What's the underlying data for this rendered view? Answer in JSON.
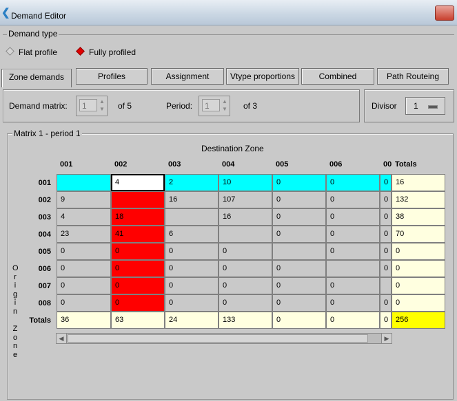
{
  "window": {
    "title": "Demand Editor"
  },
  "demand_type": {
    "label": "Demand type",
    "options": [
      {
        "label": "Flat profile",
        "selected": false
      },
      {
        "label": "Fully profiled",
        "selected": true
      }
    ]
  },
  "tabs": [
    "Zone demands",
    "Profiles",
    "Assignment",
    "Vtype proportions",
    "Combined",
    "Path Routeing"
  ],
  "active_tab": "Zone demands",
  "controls": {
    "demand_matrix_label": "Demand matrix:",
    "demand_matrix_value": "1",
    "demand_matrix_of": "of 5",
    "period_label": "Period:",
    "period_value": "1",
    "period_of": "of 3",
    "divisor_label": "Divisor",
    "divisor_value": "1"
  },
  "matrix": {
    "group_label": "Matrix 1 - period 1",
    "destination_label": "Destination Zone",
    "origin_label": [
      "O",
      "r",
      "i",
      "g",
      "i",
      "n",
      "",
      "Z",
      "o",
      "n",
      "e"
    ],
    "columns": [
      "001",
      "002",
      "003",
      "004",
      "005",
      "006",
      "00"
    ],
    "totals_col_label": "Totals",
    "totals_row_label": "Totals",
    "rows": [
      {
        "label": "001",
        "cells": [
          "",
          "4",
          "2",
          "10",
          "0",
          "0",
          "0"
        ],
        "total": "16"
      },
      {
        "label": "002",
        "cells": [
          "9",
          "",
          "16",
          "107",
          "0",
          "0",
          "0"
        ],
        "total": "132"
      },
      {
        "label": "003",
        "cells": [
          "4",
          "18",
          "",
          "16",
          "0",
          "0",
          "0"
        ],
        "total": "38"
      },
      {
        "label": "004",
        "cells": [
          "23",
          "41",
          "6",
          "",
          "0",
          "0",
          "0"
        ],
        "total": "70"
      },
      {
        "label": "005",
        "cells": [
          "0",
          "0",
          "0",
          "0",
          "",
          "0",
          "0"
        ],
        "total": "0"
      },
      {
        "label": "006",
        "cells": [
          "0",
          "0",
          "0",
          "0",
          "0",
          "",
          "0"
        ],
        "total": "0"
      },
      {
        "label": "007",
        "cells": [
          "0",
          "0",
          "0",
          "0",
          "0",
          "0",
          ""
        ],
        "total": "0"
      },
      {
        "label": "008",
        "cells": [
          "0",
          "0",
          "0",
          "0",
          "0",
          "0",
          "0"
        ],
        "total": "0"
      }
    ],
    "column_totals": [
      "36",
      "63",
      "24",
      "133",
      "0",
      "0",
      "0"
    ],
    "grand_total": "256",
    "colors": {
      "row_highlight": "#00ffff",
      "column_highlight": "#ff0000",
      "totals_bg": "#ffffe0",
      "grand_total_bg": "#ffff00"
    }
  }
}
